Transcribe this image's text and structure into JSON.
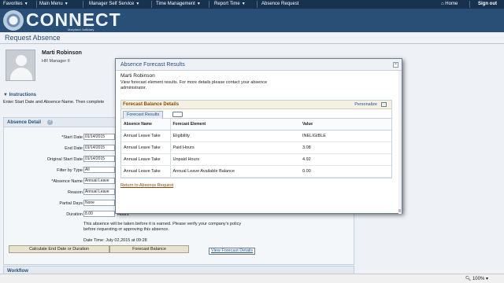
{
  "nav": {
    "favorites": "Favorites",
    "main_menu": "Main Menu",
    "manager_self_service": "Manager Self Service",
    "time_management": "Time Management",
    "report_time": "Report Time",
    "absence_request": "Absence Request",
    "home": "Home",
    "sign_out": "Sign out"
  },
  "banner": {
    "logo": "CONNECT",
    "subtitle": "Maryland Judiciary"
  },
  "page": {
    "title": "Request Absence",
    "employee_name": "Marti Robinson",
    "employee_title": "HR Manager II",
    "instructions_label": "Instructions",
    "instructions_text": "Enter Start Date and Absence Name. Then complete"
  },
  "absence_detail": {
    "header": "Absence Detail",
    "fields": {
      "start_date": {
        "label": "*Start Date",
        "value": "01/14/2015"
      },
      "end_date": {
        "label": "End Date",
        "value": "01/14/2015"
      },
      "original_start_date": {
        "label": "Original Start Date",
        "value": "01/14/2015"
      },
      "filter_by_type": {
        "label": "Filter by Type",
        "value": "All"
      },
      "absence_name": {
        "label": "*Absence Name",
        "value": "Annual Leave"
      },
      "reason": {
        "label": "Reason",
        "value": "Annual Leave"
      },
      "partial_days": {
        "label": "Partial Days",
        "value": "None"
      },
      "duration": {
        "label": "Duration",
        "value": "8.00",
        "unit": "Hours"
      }
    },
    "note": "This absence will be taken before it is earned. Please verify your company's policy before requesting or approving this absence.",
    "date_time": "Date Time: July 02,2015 at 09:28",
    "calc_button": "Calculate End Date or Duration",
    "forecast_button": "Forecast Balance",
    "view_forecast_link": "View Forecast Details"
  },
  "workflow": {
    "header": "Workflow"
  },
  "status": {
    "zoom": "100%"
  },
  "modal": {
    "title": "Absence Forecast Results",
    "close": "×",
    "employee": "Marti Robinson",
    "description": "View forecast element results. For more details please contact your absence administrator.",
    "grid_title": "Forecast Balance Details",
    "personalize": "Personalize",
    "tab_label": "Forecast Results",
    "columns": [
      "Absence Name",
      "Forecast Element",
      "Value"
    ],
    "rows": [
      [
        "Annual Leave Take",
        "Eligibility",
        "INELIGIBLE"
      ],
      [
        "Annual Leave Take",
        "Paid Hours",
        "3.08"
      ],
      [
        "Annual Leave Take",
        "Unpaid Hours",
        "4.92"
      ],
      [
        "Annual Leave Take",
        "Annual Leave Available Balance",
        "0.00"
      ]
    ],
    "return_link": "Return to Absence Request"
  }
}
